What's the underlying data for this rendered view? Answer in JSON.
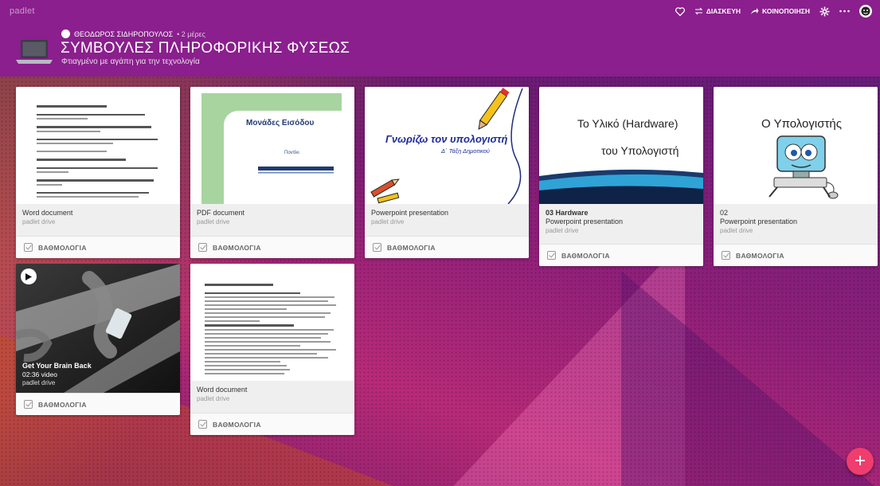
{
  "app": {
    "brand": "padlet"
  },
  "top_actions": {
    "remake": "ΔΙΑΣΚΕΥΗ",
    "share": "ΚΟΙΝΟΠΟΙΗΣΗ"
  },
  "board": {
    "author": "ΘΕΟΔΩΡΟΣ ΣΙΔΗΡΟΠΟΥΛΟΣ",
    "age": "• 2 μέρες",
    "title": "ΣΥΜΒΟΥΛΕΣ ΠΛΗΡΟΦΟΡΙΚΗΣ ΦΥΣΕΩΣ",
    "subtitle": "Φτιαγμένο με αγάπη για την τεχνολογία"
  },
  "grade_label": "ΒΑΘΜΟΛΟΓΙΑ",
  "cards": [
    {
      "title": "Word document",
      "source": "padlet drive"
    },
    {
      "title": "PDF document",
      "source": "padlet drive",
      "thumb": {
        "heading": "Μονάδες Εισόδου",
        "sub": "Ποντίκι"
      }
    },
    {
      "title": "Powerpoint presentation",
      "source": "padlet drive",
      "thumb": {
        "heading": "Γνωρίζω τον υπολογιστή",
        "sub": "Δ΄ Τάξη Δημοτικού"
      }
    },
    {
      "heading": "03 Hardware",
      "title": "Powerpoint presentation",
      "source": "padlet drive",
      "thumb": {
        "line1": "Το Υλικό (Hardware)",
        "line2": "του Υπολογιστή"
      }
    },
    {
      "heading": "02",
      "title": "Powerpoint presentation",
      "source": "padlet drive",
      "thumb": {
        "line1": "Ο Υπολογιστής"
      }
    },
    {
      "video_title": "Get Your Brain Back",
      "video_meta": "02:36 video",
      "source": "padlet drive"
    },
    {
      "title": "Word document",
      "source": "padlet drive"
    }
  ],
  "colors": {
    "header": "#8a1f8d",
    "fab": "#ef3d6e",
    "accent_green": "#a8d4a0",
    "accent_navy": "#1f3b73"
  }
}
